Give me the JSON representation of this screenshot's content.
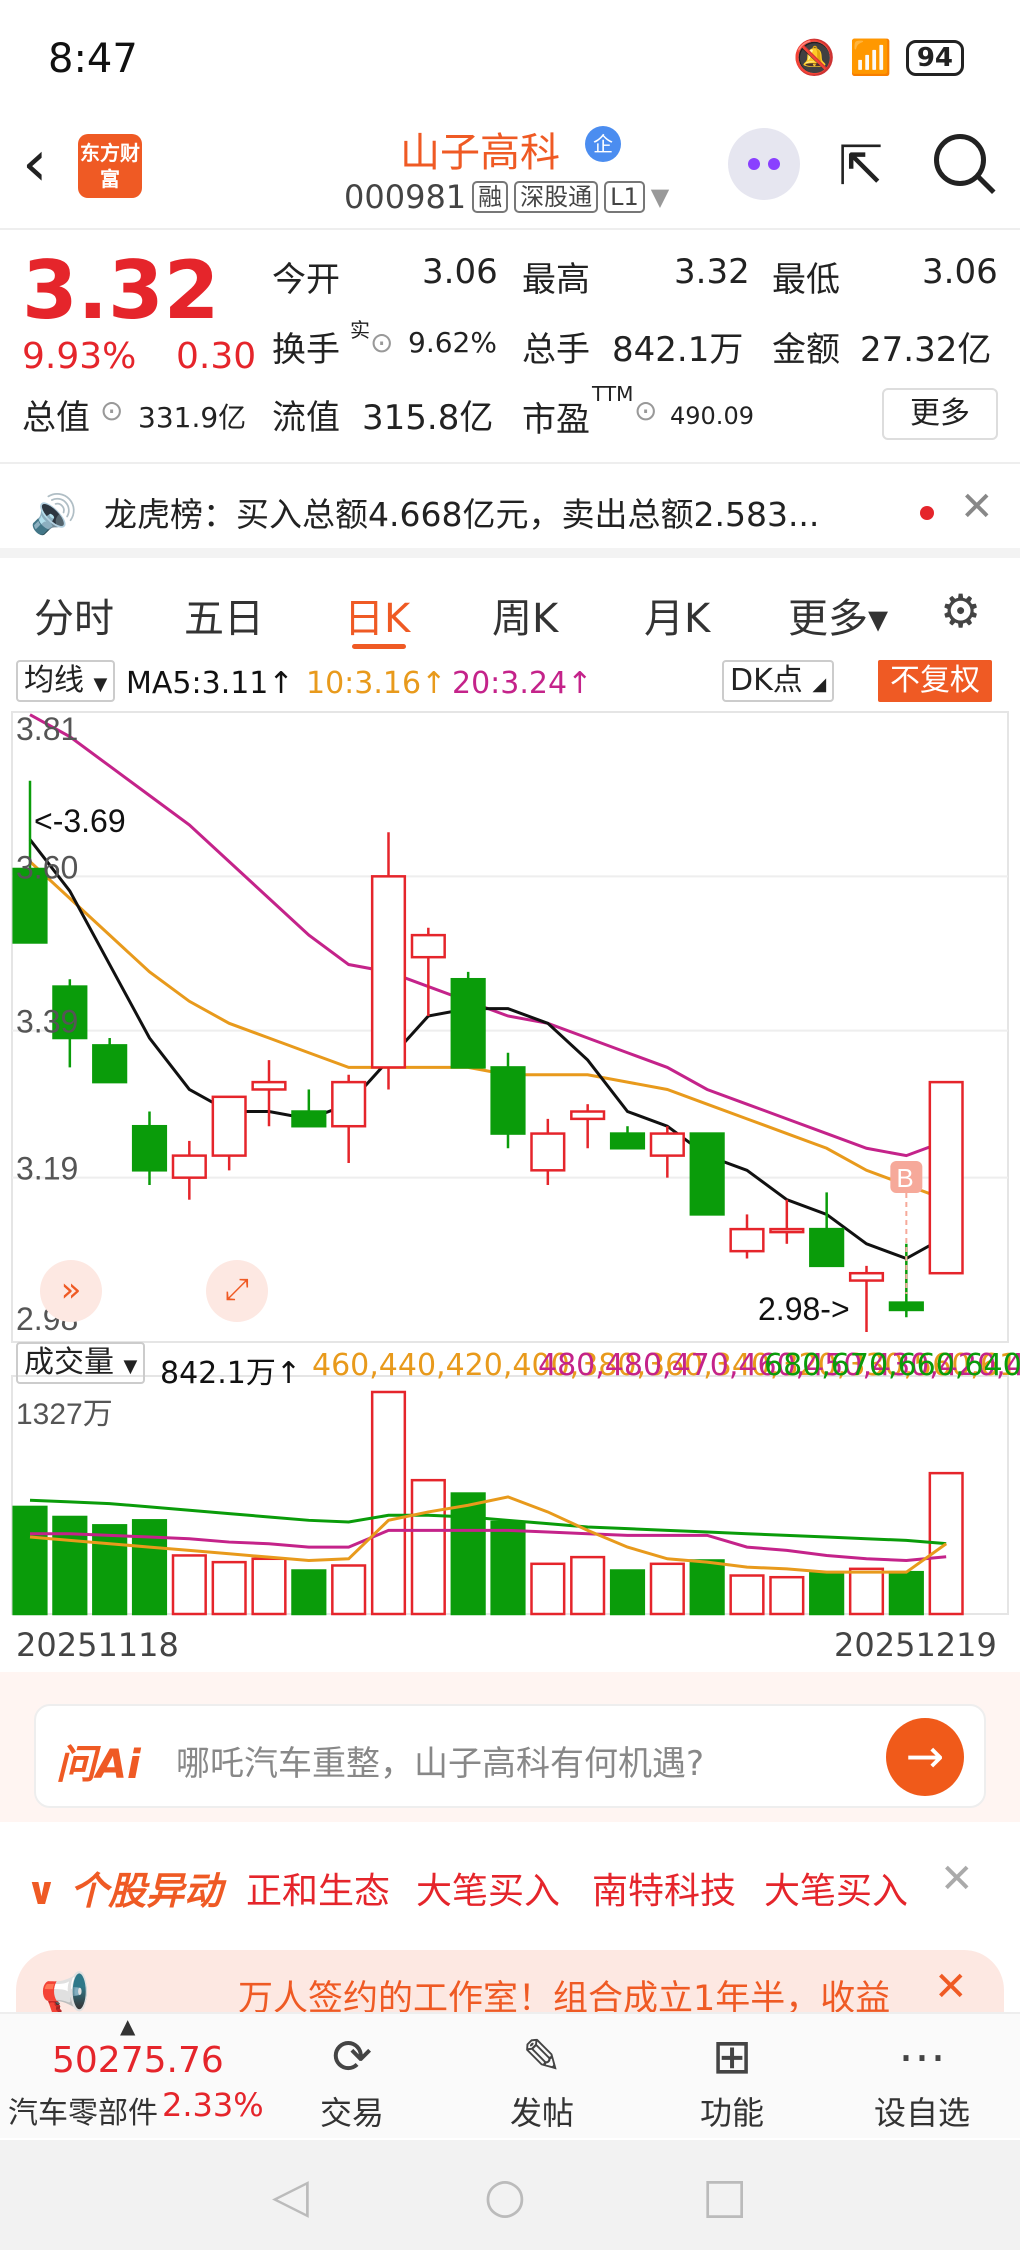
{
  "status": {
    "time": "8:47",
    "battery": "94"
  },
  "header": {
    "name": "山子高科",
    "badge": "企",
    "code": "000981",
    "tags": [
      "融",
      "深股通",
      "L1"
    ],
    "logo": "东方财富"
  },
  "quote": {
    "price": "3.32",
    "change_pct": "9.93%",
    "change": "0.30",
    "open_label": "今开",
    "open": "3.06",
    "high_label": "最高",
    "high": "3.32",
    "low_label": "最低",
    "low": "3.06",
    "turnover_label": "换手",
    "turnover_sup": "实",
    "turnover": "9.62%",
    "volume_label": "总手",
    "volume": "842.1万",
    "amount_label": "金额",
    "amount": "27.32亿",
    "mcap_label": "总值",
    "mcap": "331.9亿",
    "float_label": "流值",
    "float": "315.8亿",
    "pe_label": "市盈",
    "pe_sup": "TTM",
    "pe": "490.09",
    "more": "更多"
  },
  "notice": {
    "text": "龙虎榜：买入总额4.668亿元，卖出总额2.583..."
  },
  "tabs": [
    "分时",
    "五日",
    "日K",
    "周K",
    "月K",
    "更多▾"
  ],
  "ma_legend": {
    "select": "均线",
    "ma5": "MA5:3.11↑",
    "ma10": "10:3.16↑",
    "ma20": "20:3.24↑",
    "dk": "DK点",
    "adjust": "不复权"
  },
  "chart_data": {
    "type": "candlestick",
    "x_start": "20251118",
    "x_end": "20251219",
    "ylim": [
      2.98,
      3.81
    ],
    "y_ticks": [
      "3.81",
      "3.60",
      "3.39",
      "3.19",
      "2.98"
    ],
    "high_marker": "<-3.69",
    "low_marker": "2.98->",
    "buy_marker": "B",
    "colors": {
      "up": "#e5252b",
      "down": "#0a9c0a",
      "ma5": "#111111",
      "ma10": "#e89a1c",
      "ma20": "#c4238a"
    },
    "candles": [
      {
        "o": 3.61,
        "h": 3.73,
        "l": 3.52,
        "c": 3.51
      },
      {
        "o": 3.45,
        "h": 3.46,
        "l": 3.34,
        "c": 3.38
      },
      {
        "o": 3.37,
        "h": 3.38,
        "l": 3.32,
        "c": 3.32
      },
      {
        "o": 3.26,
        "h": 3.28,
        "l": 3.18,
        "c": 3.2
      },
      {
        "o": 3.19,
        "h": 3.24,
        "l": 3.16,
        "c": 3.22
      },
      {
        "o": 3.22,
        "h": 3.3,
        "l": 3.2,
        "c": 3.3
      },
      {
        "o": 3.31,
        "h": 3.35,
        "l": 3.26,
        "c": 3.32
      },
      {
        "o": 3.28,
        "h": 3.31,
        "l": 3.26,
        "c": 3.26
      },
      {
        "o": 3.26,
        "h": 3.33,
        "l": 3.21,
        "c": 3.32
      },
      {
        "o": 3.34,
        "h": 3.66,
        "l": 3.31,
        "c": 3.6
      },
      {
        "o": 3.49,
        "h": 3.53,
        "l": 3.41,
        "c": 3.52
      },
      {
        "o": 3.46,
        "h": 3.47,
        "l": 3.34,
        "c": 3.34
      },
      {
        "o": 3.34,
        "h": 3.36,
        "l": 3.23,
        "c": 3.25
      },
      {
        "o": 3.2,
        "h": 3.27,
        "l": 3.18,
        "c": 3.25
      },
      {
        "o": 3.27,
        "h": 3.29,
        "l": 3.23,
        "c": 3.28
      },
      {
        "o": 3.25,
        "h": 3.26,
        "l": 3.23,
        "c": 3.23
      },
      {
        "o": 3.22,
        "h": 3.26,
        "l": 3.19,
        "c": 3.25
      },
      {
        "o": 3.25,
        "h": 3.25,
        "l": 3.14,
        "c": 3.14
      },
      {
        "o": 3.09,
        "h": 3.14,
        "l": 3.08,
        "c": 3.12
      },
      {
        "o": 3.12,
        "h": 3.16,
        "l": 3.1,
        "c": 3.12
      },
      {
        "o": 3.12,
        "h": 3.17,
        "l": 3.07,
        "c": 3.07
      },
      {
        "o": 3.05,
        "h": 3.07,
        "l": 2.98,
        "c": 3.06
      },
      {
        "o": 3.02,
        "h": 3.1,
        "l": 3.0,
        "c": 3.01
      },
      {
        "o": 3.06,
        "h": 3.32,
        "l": 3.06,
        "c": 3.32
      }
    ],
    "ma5": [
      3.65,
      3.58,
      3.48,
      3.38,
      3.31,
      3.28,
      3.28,
      3.27,
      3.29,
      3.35,
      3.41,
      3.42,
      3.42,
      3.4,
      3.35,
      3.28,
      3.26,
      3.22,
      3.2,
      3.16,
      3.14,
      3.1,
      3.08,
      3.11
    ],
    "ma10": [
      3.62,
      3.57,
      3.52,
      3.47,
      3.43,
      3.4,
      3.38,
      3.36,
      3.34,
      3.34,
      3.34,
      3.34,
      3.33,
      3.33,
      3.33,
      3.32,
      3.31,
      3.29,
      3.27,
      3.25,
      3.23,
      3.2,
      3.18,
      3.16
    ],
    "ma20": [
      3.82,
      3.79,
      3.75,
      3.71,
      3.67,
      3.62,
      3.57,
      3.52,
      3.48,
      3.47,
      3.45,
      3.43,
      3.41,
      3.4,
      3.38,
      3.36,
      3.34,
      3.31,
      3.29,
      3.27,
      3.25,
      3.23,
      3.22,
      3.24
    ],
    "volume": {
      "label": "成交量",
      "current": "842.1万↑",
      "ma1": [
        460,
        440,
        420,
        400,
        380,
        360,
        340,
        320,
        330,
        560,
        610,
        650,
        700,
        610,
        500,
        400,
        330,
        310,
        280,
        270,
        250,
        250,
        250,
        420
      ],
      "ma2": [
        480,
        480,
        470,
        460,
        450,
        430,
        420,
        400,
        400,
        500,
        500,
        500,
        500,
        490,
        480,
        470,
        470,
        470,
        400,
        380,
        350,
        330,
        320,
        342
      ],
      "ma3": [
        680,
        670,
        660,
        640,
        620,
        600,
        580,
        560,
        550,
        590,
        590,
        580,
        560,
        540,
        520,
        510,
        500,
        490,
        480,
        470,
        460,
        450,
        440,
        421
      ],
      "max_label": "1327万",
      "ylim": [
        0,
        1327
      ],
      "values": [
        640,
        580,
        530,
        560,
        350,
        310,
        330,
        260,
        290,
        1327,
        800,
        720,
        550,
        300,
        340,
        260,
        300,
        320,
        230,
        220,
        250,
        270,
        250,
        842
      ]
    }
  },
  "ai": {
    "logo": "问Ai",
    "text": "哪吒汽车重整，山子高科有何机遇?"
  },
  "abnormal": {
    "title": "个股异动",
    "items": [
      "正和生态",
      "大笔买入",
      "南特科技",
      "大笔买入"
    ]
  },
  "banner": {
    "text": "万人签约的工作室！组合成立1年半，收益"
  },
  "bottomnav": {
    "index_value": "50275.76",
    "index_name": "汽车零部件",
    "index_pct": "2.33%",
    "items": [
      "交易",
      "发帖",
      "功能",
      "设自选"
    ]
  }
}
